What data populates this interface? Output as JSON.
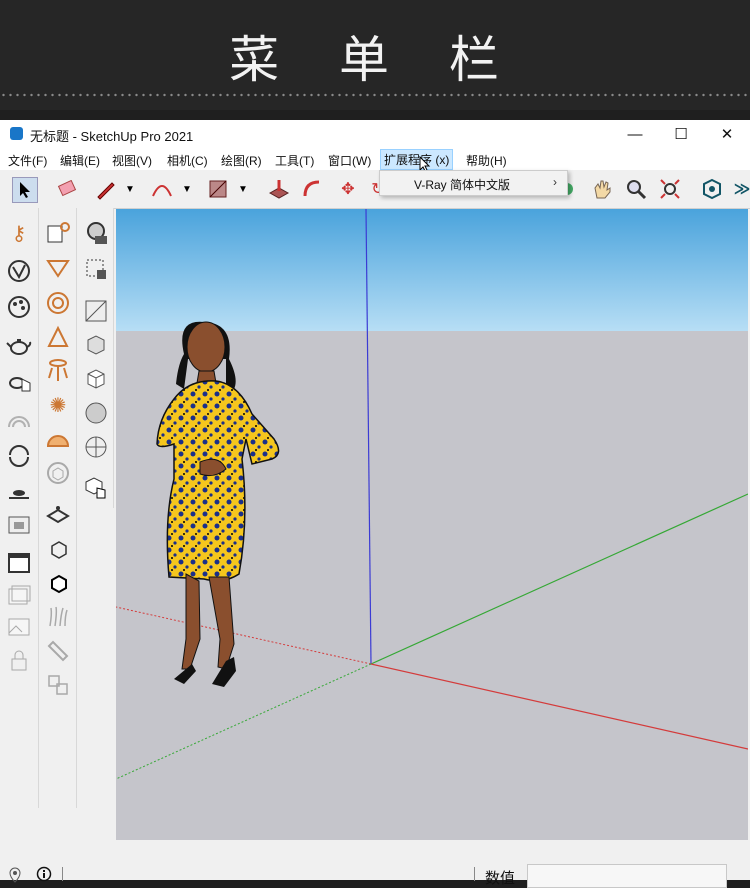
{
  "banner": {
    "title": "菜 单 栏"
  },
  "window": {
    "title": "无标题 - SketchUp Pro 2021",
    "controls": {
      "minimize": "—",
      "maximize": "☐",
      "close": "✕"
    }
  },
  "menu": {
    "items": [
      {
        "label": "文件(F)"
      },
      {
        "label": "编辑(E)"
      },
      {
        "label": "视图(V)"
      },
      {
        "label": "相机(C)"
      },
      {
        "label": "绘图(R)"
      },
      {
        "label": "工具(T)"
      },
      {
        "label": "窗口(W)"
      },
      {
        "label": "扩展程序 (x)"
      },
      {
        "label": "帮助(H)"
      }
    ],
    "open_dropdown": {
      "item": "V-Ray 简体中文版",
      "arrow": "›"
    }
  },
  "status": {
    "label": "数值",
    "value": ""
  },
  "icons": {
    "toolbar": [
      "select-arrow-icon",
      "eraser-icon",
      "pencil-icon",
      "arc-icon",
      "rectangle-icon",
      "push-pull-icon",
      "follow-me-icon",
      "move-icon",
      "orbit-icon",
      "pan-icon",
      "zoom-icon",
      "zoom-extents-icon",
      "extension-warehouse-icon"
    ],
    "status": [
      "geo-location-icon",
      "info-icon"
    ]
  },
  "colors": {
    "sky_top": "#4aa3dc",
    "ground": "#c5c5cb",
    "axis_red": "#d43b3b",
    "axis_green": "#35a835",
    "axis_blue": "#3b3bd4"
  }
}
